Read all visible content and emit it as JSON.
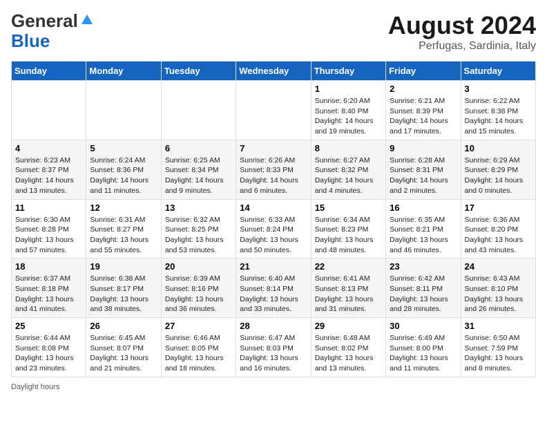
{
  "header": {
    "logo_line1": "General",
    "logo_line2": "Blue",
    "main_title": "August 2024",
    "subtitle": "Perfugas, Sardinia, Italy"
  },
  "calendar": {
    "days_of_week": [
      "Sunday",
      "Monday",
      "Tuesday",
      "Wednesday",
      "Thursday",
      "Friday",
      "Saturday"
    ],
    "weeks": [
      [
        {
          "day": "",
          "info": ""
        },
        {
          "day": "",
          "info": ""
        },
        {
          "day": "",
          "info": ""
        },
        {
          "day": "",
          "info": ""
        },
        {
          "day": "1",
          "info": "Sunrise: 6:20 AM\nSunset: 8:40 PM\nDaylight: 14 hours and 19 minutes."
        },
        {
          "day": "2",
          "info": "Sunrise: 6:21 AM\nSunset: 8:39 PM\nDaylight: 14 hours and 17 minutes."
        },
        {
          "day": "3",
          "info": "Sunrise: 6:22 AM\nSunset: 8:38 PM\nDaylight: 14 hours and 15 minutes."
        }
      ],
      [
        {
          "day": "4",
          "info": "Sunrise: 6:23 AM\nSunset: 8:37 PM\nDaylight: 14 hours and 13 minutes."
        },
        {
          "day": "5",
          "info": "Sunrise: 6:24 AM\nSunset: 8:36 PM\nDaylight: 14 hours and 11 minutes."
        },
        {
          "day": "6",
          "info": "Sunrise: 6:25 AM\nSunset: 8:34 PM\nDaylight: 14 hours and 9 minutes."
        },
        {
          "day": "7",
          "info": "Sunrise: 6:26 AM\nSunset: 8:33 PM\nDaylight: 14 hours and 6 minutes."
        },
        {
          "day": "8",
          "info": "Sunrise: 6:27 AM\nSunset: 8:32 PM\nDaylight: 14 hours and 4 minutes."
        },
        {
          "day": "9",
          "info": "Sunrise: 6:28 AM\nSunset: 8:31 PM\nDaylight: 14 hours and 2 minutes."
        },
        {
          "day": "10",
          "info": "Sunrise: 6:29 AM\nSunset: 8:29 PM\nDaylight: 14 hours and 0 minutes."
        }
      ],
      [
        {
          "day": "11",
          "info": "Sunrise: 6:30 AM\nSunset: 8:28 PM\nDaylight: 13 hours and 57 minutes."
        },
        {
          "day": "12",
          "info": "Sunrise: 6:31 AM\nSunset: 8:27 PM\nDaylight: 13 hours and 55 minutes."
        },
        {
          "day": "13",
          "info": "Sunrise: 6:32 AM\nSunset: 8:25 PM\nDaylight: 13 hours and 53 minutes."
        },
        {
          "day": "14",
          "info": "Sunrise: 6:33 AM\nSunset: 8:24 PM\nDaylight: 13 hours and 50 minutes."
        },
        {
          "day": "15",
          "info": "Sunrise: 6:34 AM\nSunset: 8:23 PM\nDaylight: 13 hours and 48 minutes."
        },
        {
          "day": "16",
          "info": "Sunrise: 6:35 AM\nSunset: 8:21 PM\nDaylight: 13 hours and 46 minutes."
        },
        {
          "day": "17",
          "info": "Sunrise: 6:36 AM\nSunset: 8:20 PM\nDaylight: 13 hours and 43 minutes."
        }
      ],
      [
        {
          "day": "18",
          "info": "Sunrise: 6:37 AM\nSunset: 8:18 PM\nDaylight: 13 hours and 41 minutes."
        },
        {
          "day": "19",
          "info": "Sunrise: 6:38 AM\nSunset: 8:17 PM\nDaylight: 13 hours and 38 minutes."
        },
        {
          "day": "20",
          "info": "Sunrise: 6:39 AM\nSunset: 8:16 PM\nDaylight: 13 hours and 36 minutes."
        },
        {
          "day": "21",
          "info": "Sunrise: 6:40 AM\nSunset: 8:14 PM\nDaylight: 13 hours and 33 minutes."
        },
        {
          "day": "22",
          "info": "Sunrise: 6:41 AM\nSunset: 8:13 PM\nDaylight: 13 hours and 31 minutes."
        },
        {
          "day": "23",
          "info": "Sunrise: 6:42 AM\nSunset: 8:11 PM\nDaylight: 13 hours and 28 minutes."
        },
        {
          "day": "24",
          "info": "Sunrise: 6:43 AM\nSunset: 8:10 PM\nDaylight: 13 hours and 26 minutes."
        }
      ],
      [
        {
          "day": "25",
          "info": "Sunrise: 6:44 AM\nSunset: 8:08 PM\nDaylight: 13 hours and 23 minutes."
        },
        {
          "day": "26",
          "info": "Sunrise: 6:45 AM\nSunset: 8:07 PM\nDaylight: 13 hours and 21 minutes."
        },
        {
          "day": "27",
          "info": "Sunrise: 6:46 AM\nSunset: 8:05 PM\nDaylight: 13 hours and 18 minutes."
        },
        {
          "day": "28",
          "info": "Sunrise: 6:47 AM\nSunset: 8:03 PM\nDaylight: 13 hours and 16 minutes."
        },
        {
          "day": "29",
          "info": "Sunrise: 6:48 AM\nSunset: 8:02 PM\nDaylight: 13 hours and 13 minutes."
        },
        {
          "day": "30",
          "info": "Sunrise: 6:49 AM\nSunset: 8:00 PM\nDaylight: 13 hours and 11 minutes."
        },
        {
          "day": "31",
          "info": "Sunrise: 6:50 AM\nSunset: 7:59 PM\nDaylight: 13 hours and 8 minutes."
        }
      ]
    ]
  },
  "footer": {
    "daylight_label": "Daylight hours"
  }
}
